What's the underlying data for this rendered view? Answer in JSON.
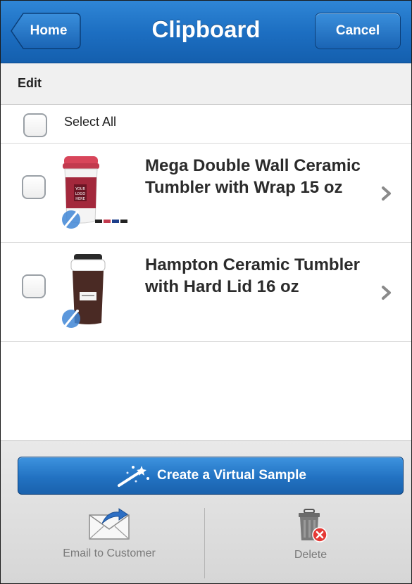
{
  "header": {
    "back_label": "Home",
    "title": "Clipboard",
    "cancel_label": "Cancel"
  },
  "edit_bar": {
    "label": "Edit"
  },
  "select_all": {
    "label": "Select All",
    "checked": false
  },
  "products": [
    {
      "title": "Mega Double Wall Ceramic Tumbler with Wrap 15 oz",
      "checked": false,
      "thumb_icon": "red-tumbler-icon"
    },
    {
      "title": "Hampton Ceramic Tumbler with Hard Lid 16 oz",
      "checked": false,
      "thumb_icon": "brown-tumbler-icon"
    }
  ],
  "actions": {
    "virtual_sample_label": "Create a Virtual Sample",
    "email_label": "Email to Customer",
    "delete_label": "Delete"
  },
  "colors": {
    "header_blue": "#1d6fc2",
    "button_blue": "#2272c2",
    "delete_badge": "#e53935"
  }
}
